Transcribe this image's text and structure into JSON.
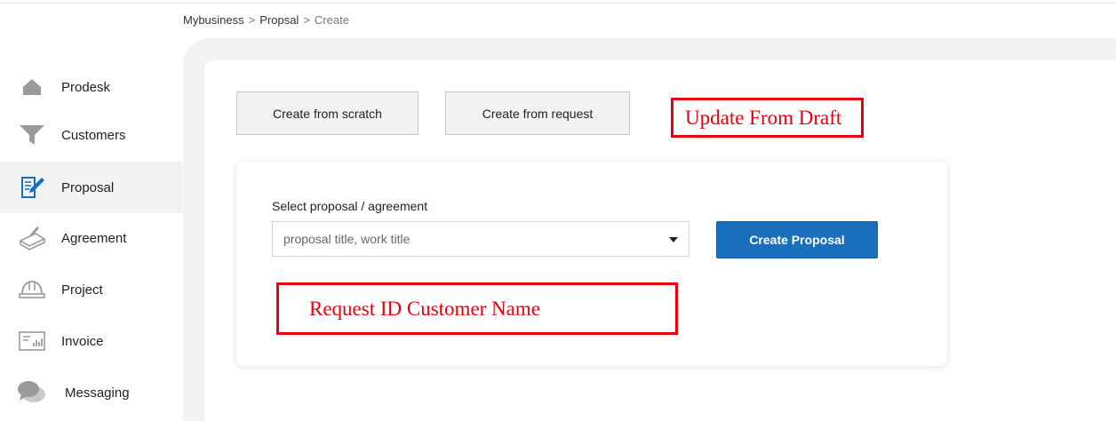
{
  "breadcrumb": {
    "items": [
      "Mybusiness",
      "Propsal"
    ],
    "separator": ">",
    "current": "Create"
  },
  "sidebar": {
    "active_index": 2,
    "items": [
      {
        "label": "Prodesk",
        "icon": "home-icon"
      },
      {
        "label": "Customers",
        "icon": "funnel-icon"
      },
      {
        "label": "Proposal",
        "icon": "proposal-document-icon"
      },
      {
        "label": "Agreement",
        "icon": "agreement-icon"
      },
      {
        "label": "Project",
        "icon": "hardhat-icon"
      },
      {
        "label": "Invoice",
        "icon": "invoice-icon"
      },
      {
        "label": "Messaging",
        "icon": "chat-bubbles-icon"
      }
    ]
  },
  "toolbar": {
    "create_scratch_label": "Create from scratch",
    "create_request_label": "Create from request"
  },
  "annotations": {
    "update_draft": "Update From Draft",
    "request_info": "Request ID Customer Name"
  },
  "form": {
    "select_label": "Select proposal / agreement",
    "select_placeholder": "proposal title, work title",
    "submit_label": "Create Proposal"
  },
  "colors": {
    "primary": "#1a6fbd",
    "annotation": "#e8000b",
    "canvas_bg": "#f1f2f1",
    "icon_gray": "#9a9a9a",
    "icon_blue": "#1a6fbd"
  }
}
